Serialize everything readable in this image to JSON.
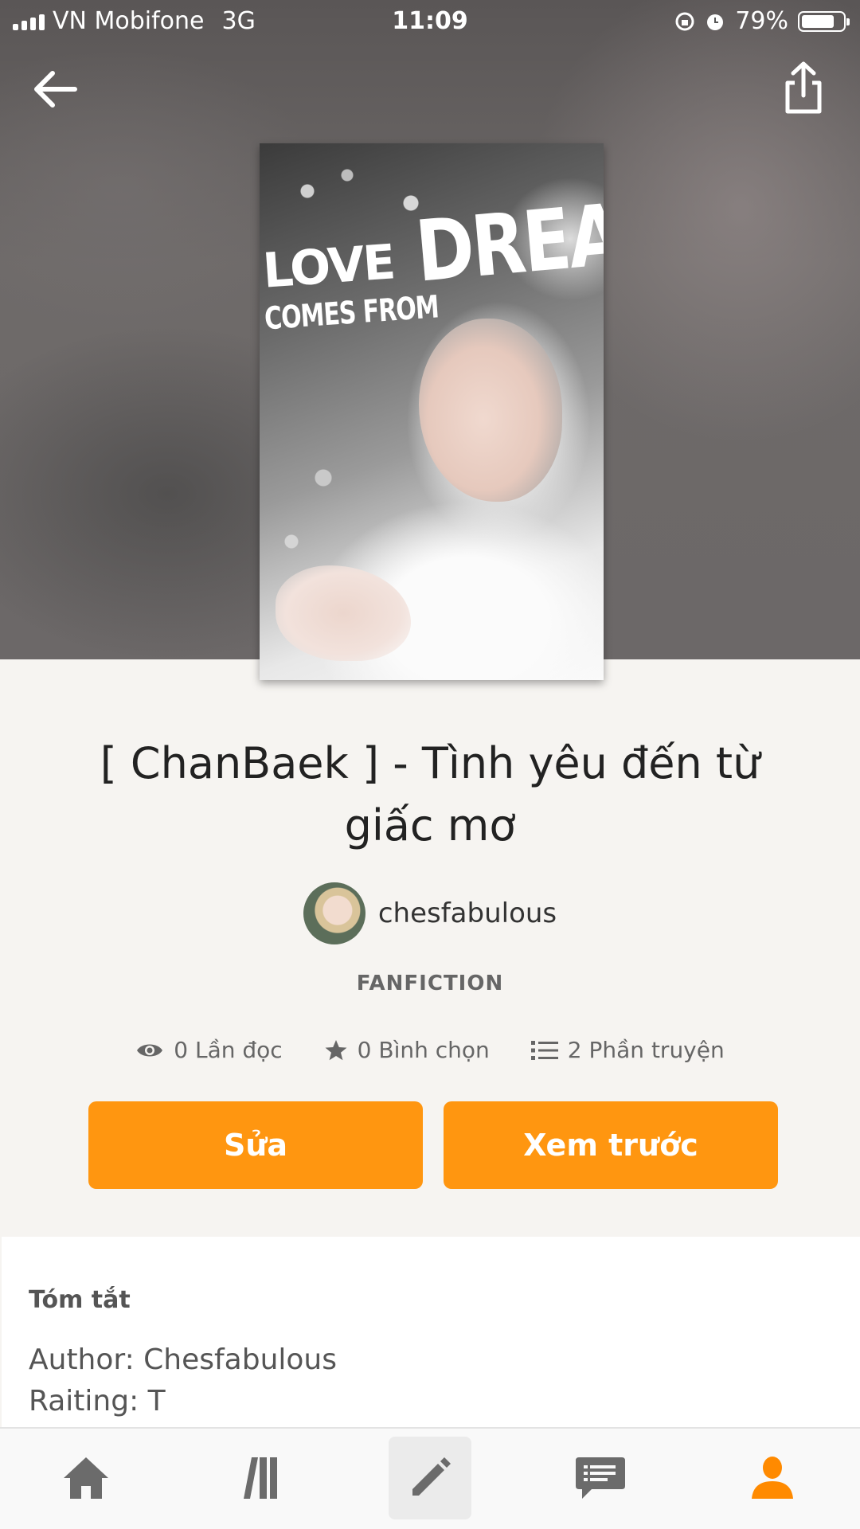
{
  "status_bar": {
    "carrier": "VN Mobifone",
    "network": "3G",
    "time": "11:09",
    "battery": "79%",
    "battery_level": 0.79
  },
  "header": {
    "back_icon": "arrow-left-icon",
    "share_icon": "share-icon"
  },
  "cover": {
    "line1": "LOVE",
    "line2": "COMES FROM",
    "line3": "DREAM"
  },
  "story": {
    "title": "[ ChanBaek ] - Tình yêu đến từ giấc mơ",
    "author": "chesfabulous",
    "category": "FANFICTION"
  },
  "stats": {
    "reads": "0 Lần đọc",
    "votes": "0 Bình chọn",
    "parts": "2 Phần truyện"
  },
  "actions": {
    "edit_label": "Sửa",
    "preview_label": "Xem trước"
  },
  "summary": {
    "heading": "Tóm tắt",
    "lines": [
      "Author: Chesfabulous",
      "Raiting: T"
    ]
  },
  "bottom_nav": {
    "items": [
      "home-icon",
      "library-icon",
      "write-icon",
      "messages-icon",
      "profile-icon"
    ],
    "active": "profile-icon"
  },
  "colors": {
    "accent": "#ff9610",
    "background": "#f6f4f1",
    "active_nav": "#ff8a00",
    "inactive_nav": "#6b6b6b"
  }
}
